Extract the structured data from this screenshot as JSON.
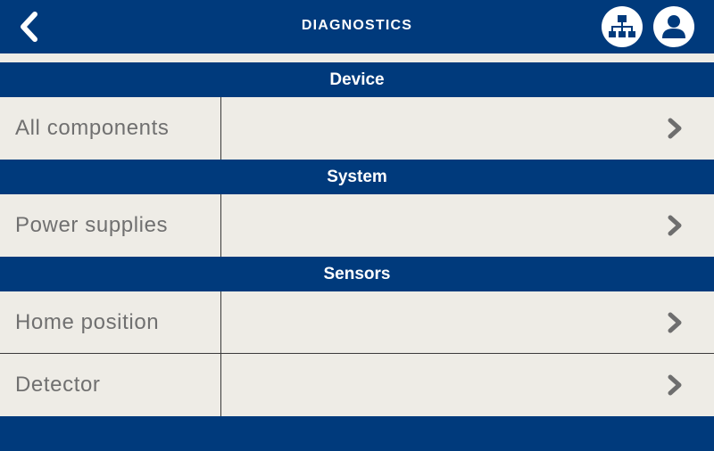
{
  "header": {
    "title": "DIAGNOSTICS",
    "back_icon": "chevron-left-icon",
    "network_icon": "network-hierarchy-icon",
    "user_icon": "user-icon"
  },
  "colors": {
    "primary": "#003a7c",
    "background": "#eeece6",
    "label_text": "#707070",
    "chevron": "#6e6e6e"
  },
  "sections": [
    {
      "title": "Device",
      "items": [
        {
          "label": "All components"
        }
      ]
    },
    {
      "title": "System",
      "items": [
        {
          "label": "Power supplies"
        }
      ]
    },
    {
      "title": "Sensors",
      "items": [
        {
          "label": "Home position"
        },
        {
          "label": "Detector"
        }
      ]
    }
  ]
}
